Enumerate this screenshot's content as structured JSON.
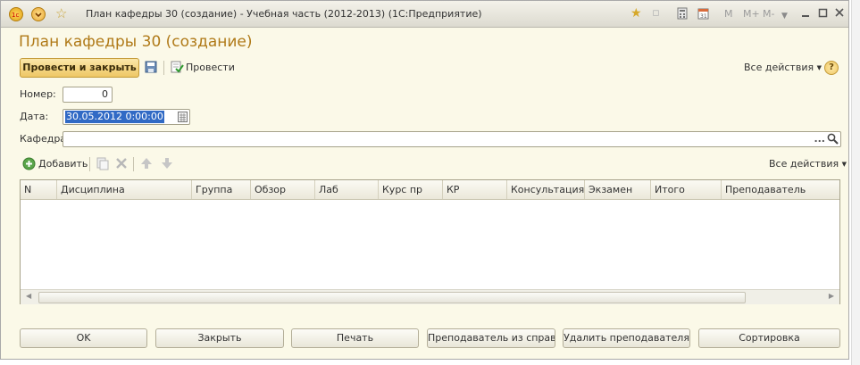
{
  "window": {
    "title": "План кафедры 30 (создание) - Учебная часть (2012-2013)  (1С:Предприятие)",
    "mem_buttons": [
      "M",
      "M+",
      "M-"
    ]
  },
  "form": {
    "title": "План кафедры 30 (создание)"
  },
  "toolbar": {
    "post_close_label": "Провести и закрыть",
    "post_label": "Провести",
    "all_actions_label": "Все действия",
    "help_label": "?"
  },
  "fields": {
    "number_label": "Номер:",
    "number_value": "0",
    "date_label": "Дата:",
    "date_value": "30.05.2012  0:00:00",
    "dept_label": "Кафедра:",
    "dept_value": "",
    "dept_select_label": "..."
  },
  "table_toolbar": {
    "add_label": "Добавить",
    "all_actions_label": "Все действия"
  },
  "table": {
    "columns": [
      "N",
      "Дисциплина",
      "Группа",
      "Обзор",
      "Лаб",
      "Курс пр",
      "КР",
      "Консультация",
      "Экзамен",
      "Итого",
      "Преподаватель"
    ],
    "rows": []
  },
  "buttons": {
    "ok": "OK",
    "close": "Закрыть",
    "print": "Печать",
    "teacher_from_ref": "Преподаватель из справ...",
    "delete_teacher": "Удалить преподавателя",
    "sort": "Сортировка"
  },
  "colors": {
    "title_accent": "#b07a18",
    "form_background": "#fbf9e8",
    "primary_button": "#eec765",
    "selection": "#316ac5"
  }
}
